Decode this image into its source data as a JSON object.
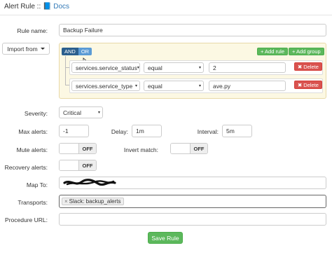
{
  "header": {
    "title": "Alert Rule :: ",
    "docs_link": "Docs"
  },
  "form": {
    "rule_name_label": "Rule name:",
    "rule_name_value": "Backup Failure",
    "import_from_label": "Import from",
    "builder": {
      "and_label": "AND",
      "or_label": "OR",
      "add_rule_label": "+ Add rule",
      "add_group_label": "+ Add group",
      "rules": [
        {
          "field": "services.service_status",
          "operator": "equal",
          "value": "2",
          "delete_label": "Delete"
        },
        {
          "field": "services.service_type",
          "operator": "equal",
          "value": "ave.py",
          "delete_label": "Delete"
        }
      ]
    },
    "severity_label": "Severity:",
    "severity_value": "Critical",
    "max_alerts_label": "Max alerts:",
    "max_alerts_value": "-1",
    "delay_label": "Delay:",
    "delay_value": "1m",
    "interval_label": "Interval:",
    "interval_value": "5m",
    "mute_alerts_label": "Mute alerts:",
    "mute_alerts_state": "OFF",
    "invert_match_label": "Invert match:",
    "invert_match_state": "OFF",
    "recovery_alerts_label": "Recovery alerts:",
    "recovery_alerts_state": "OFF",
    "map_to_label": "Map To:",
    "transports_label": "Transports:",
    "transport_tag": "Slack: backup_alerts",
    "procedure_url_label": "Procedure URL:",
    "save_label": "Save Rule"
  },
  "colors": {
    "primary_link": "#337ab7",
    "success": "#5cb85c",
    "danger": "#d9534f",
    "builder_bg": "#fcf8e3"
  }
}
